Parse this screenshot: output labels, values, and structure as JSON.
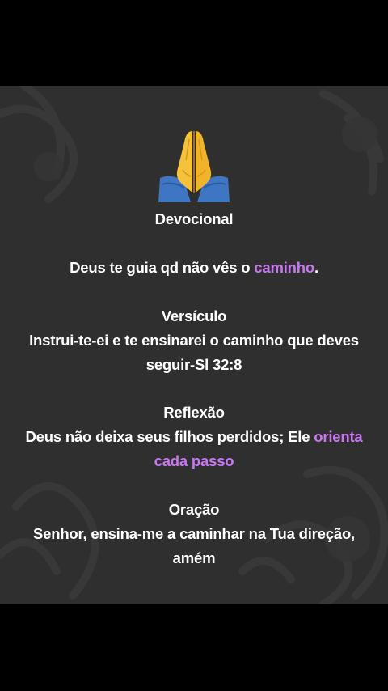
{
  "post": {
    "icon": "folded-hands-icon",
    "title": "Devocional",
    "headline": {
      "before": "Deus te guia qd não vês o ",
      "accent": "caminho",
      "after": "."
    },
    "verse_heading": "Versículo",
    "verse_line1": "Instrui-te-ei e te ensinarei o caminho que deves",
    "verse_line2": "seguir-Sl 32:8",
    "reflection_heading": "Reflexão",
    "reflection_line1": {
      "before": "Deus não deixa seus filhos perdidos; Ele ",
      "accent": "orienta"
    },
    "reflection_line2": {
      "accent": "cada passo"
    },
    "prayer_heading": "Oração",
    "prayer_line1": "Senhor, ensina-me a caminhar na Tua direção,",
    "prayer_line2": "amém"
  },
  "colors": {
    "background": "#000000",
    "card": "#2f2f2f",
    "text": "#ffffff",
    "accent": "#c977ef"
  }
}
